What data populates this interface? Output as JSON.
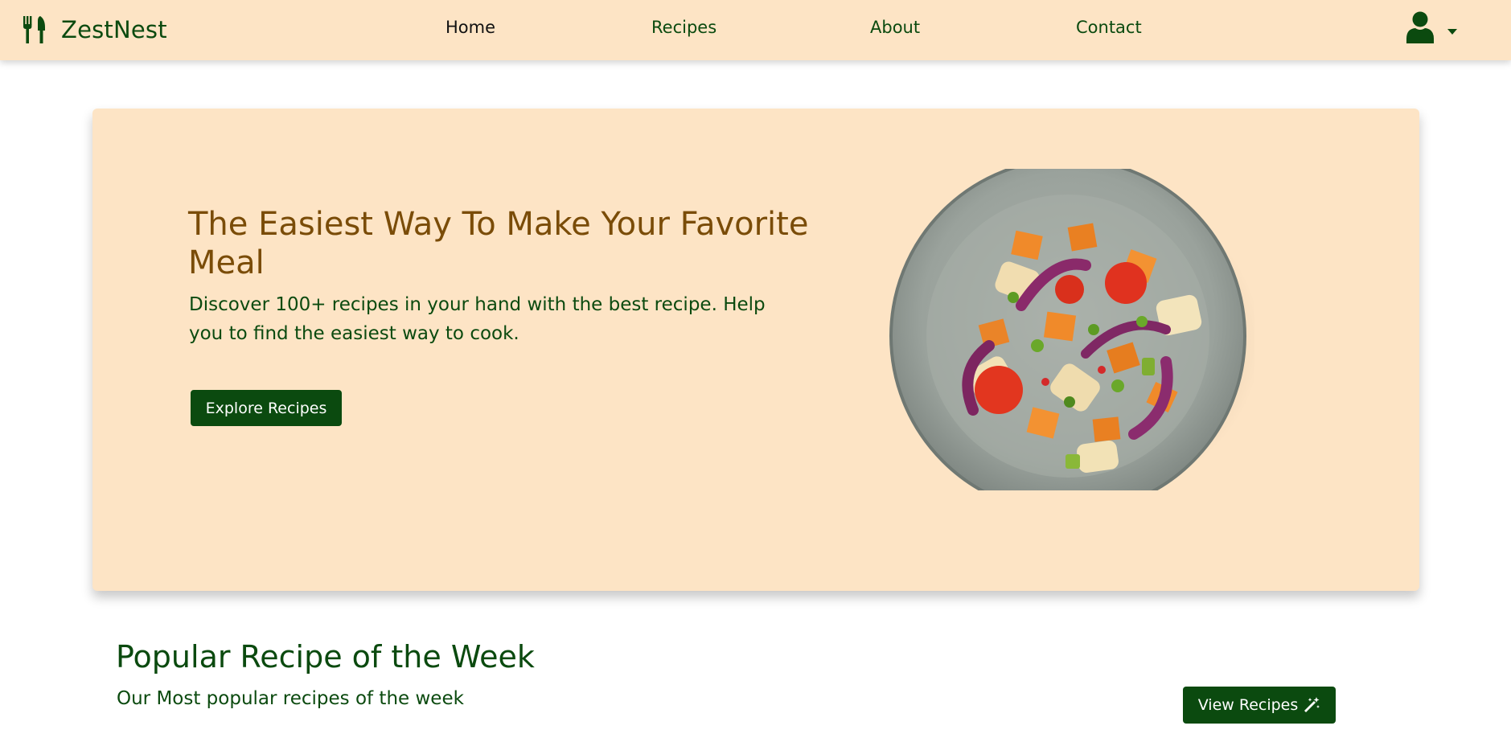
{
  "navbar": {
    "brand_icon": "fork-knife-icon",
    "brand_name": "ZestNest",
    "links": [
      {
        "label": "Home",
        "active": true
      },
      {
        "label": "Recipes",
        "active": false
      },
      {
        "label": "About",
        "active": false
      },
      {
        "label": "Contact",
        "active": false
      }
    ],
    "user_icon": "user-icon",
    "dropdown_icon": "caret-down-icon"
  },
  "hero": {
    "title": "The Easiest Way To Make Your Favorite Meal",
    "subtitle": "Discover 100+ recipes in your hand with the best recipe. Help you to find the easiest way to cook.",
    "cta_label": "Explore Recipes",
    "image": "salad-bowl-image"
  },
  "popular": {
    "title": "Popular Recipe of the Week",
    "subtitle": "Our Most popular recipes of the week",
    "button_label": "View Recipes",
    "button_icon": "magic-wand-icon"
  },
  "colors": {
    "primary_green": "#0b4a0f",
    "peach_background": "#fde4c5",
    "title_brown": "#7a4c08"
  }
}
